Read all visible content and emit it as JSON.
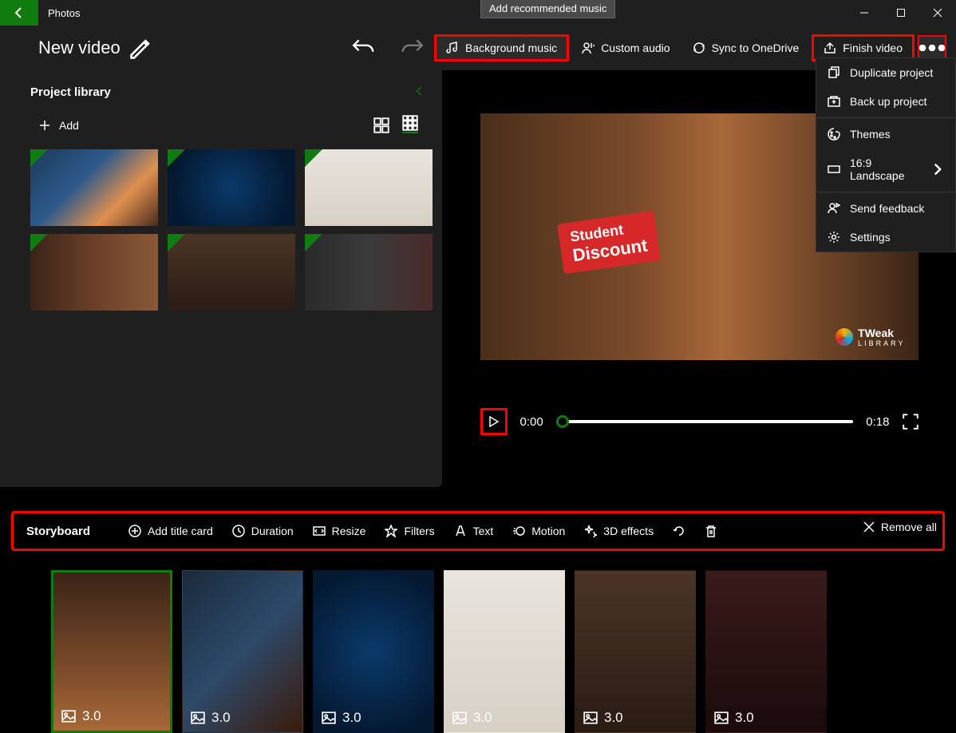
{
  "app": {
    "name": "Photos"
  },
  "header": {
    "title": "New video",
    "tooltip": "Add recommended music",
    "buttons": {
      "bg_music": "Background music",
      "custom_audio": "Custom audio",
      "sync": "Sync to OneDrive",
      "finish": "Finish video"
    }
  },
  "dropdown": {
    "duplicate": "Duplicate project",
    "backup": "Back up project",
    "themes": "Themes",
    "aspect": "16:9 Landscape",
    "feedback": "Send feedback",
    "settings": "Settings"
  },
  "library": {
    "title": "Project library",
    "add": "Add"
  },
  "preview": {
    "badge_line1": "Student",
    "badge_line2": "Discount",
    "wm_brand": "TWeak",
    "wm_sub": "LIBRARY"
  },
  "player": {
    "current": "0:00",
    "total": "0:18"
  },
  "storyboard": {
    "title": "Storyboard",
    "add_title": "Add title card",
    "duration": "Duration",
    "resize": "Resize",
    "filters": "Filters",
    "text": "Text",
    "motion": "Motion",
    "effects": "3D effects",
    "remove_all": "Remove all"
  },
  "clips": [
    {
      "dur": "3.0"
    },
    {
      "dur": "3.0"
    },
    {
      "dur": "3.0"
    },
    {
      "dur": "3.0"
    },
    {
      "dur": "3.0"
    },
    {
      "dur": "3.0"
    }
  ]
}
